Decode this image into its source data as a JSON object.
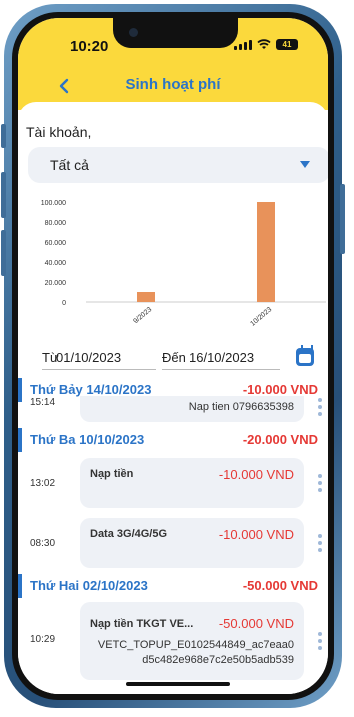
{
  "status_bar": {
    "time": "10:20",
    "battery": "41"
  },
  "header": {
    "title": "Sinh hoạt phí"
  },
  "filter": {
    "account_label": "Tài khoản,",
    "account_value": "Tất cả"
  },
  "chart_data": {
    "type": "bar",
    "categories": [
      "9/2023",
      "10/2023"
    ],
    "values": [
      10000,
      100000
    ],
    "ylim": [
      0,
      100000
    ],
    "yticks": [
      "0",
      "20.000",
      "40.000",
      "60.000",
      "80.000",
      "100.000"
    ],
    "bar_color": "#e8925a"
  },
  "date_range": {
    "from_label": "Từ",
    "from_value": "01/10/2023",
    "to_label": "Đến",
    "to_value": "16/10/2023"
  },
  "days": [
    {
      "name": "Thứ Bảy 14/10/2023",
      "total": "-10.000 VND"
    },
    {
      "name": "Thứ Ba 10/10/2023",
      "total": "-20.000 VND"
    },
    {
      "name": "Thứ Hai 02/10/2023",
      "total": "-50.000 VND"
    }
  ],
  "transactions": [
    {
      "time": "15:14",
      "name": "",
      "amount": "",
      "desc": "Nap tien 0796635398"
    },
    {
      "time": "13:02",
      "name": "Nạp tiền",
      "amount": "-10.000 VND",
      "desc": ""
    },
    {
      "time": "08:30",
      "name": "Data 3G/4G/5G",
      "amount": "-10.000 VND",
      "desc": ""
    },
    {
      "time": "10:29",
      "name": "Nạp tiền TKGT VE...",
      "amount": "-50.000 VND",
      "desc1": "VETC_TOPUP_E0102544849_ac7eaa0",
      "desc2": "d5c482e968e7c2e50b5adb539"
    }
  ],
  "colors": {
    "accent": "#2b74c7",
    "header_bg": "#fbd93c",
    "negative": "#e53935"
  }
}
